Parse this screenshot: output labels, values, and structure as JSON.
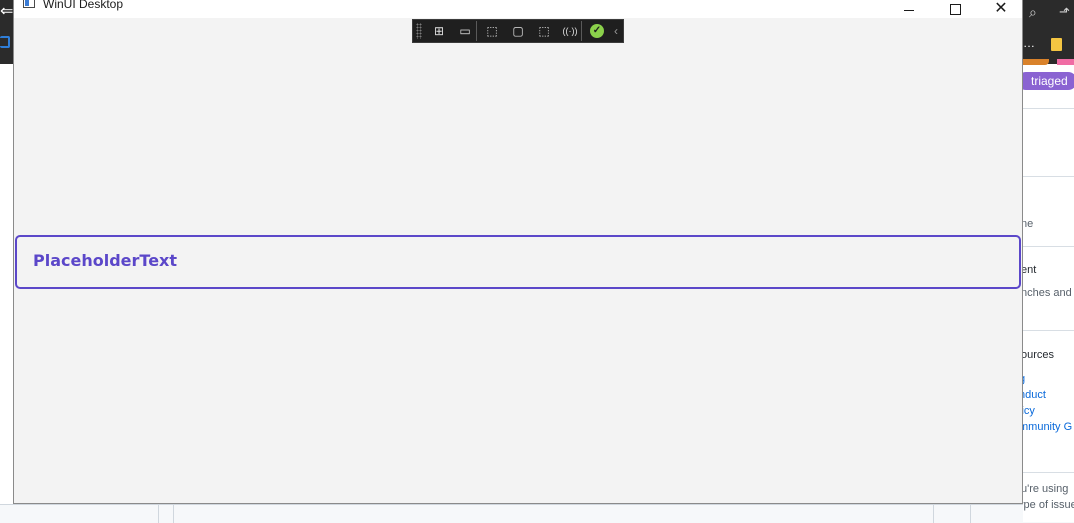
{
  "window": {
    "title": "WinUI Desktop",
    "controls": {
      "minimize": "–",
      "maximize": "□",
      "close": "✕"
    }
  },
  "debug_toolbar": {
    "buttons": [
      {
        "name": "live-visual-tree-icon",
        "glyph": "⊞"
      },
      {
        "name": "record-icon",
        "glyph": "▭"
      },
      {
        "name": "select-element-icon",
        "glyph": "⬚"
      },
      {
        "name": "display-layout-adorners-icon",
        "glyph": "▢"
      },
      {
        "name": "track-focus-icon",
        "glyph": "⬚"
      },
      {
        "name": "hot-reload-icon",
        "glyph": "((·))"
      },
      {
        "name": "accessibility-check-icon",
        "glyph": "✓"
      }
    ],
    "collapse_glyph": "‹"
  },
  "text_field": {
    "placeholder": "PlaceholderText",
    "accent": "#5b47c9"
  },
  "background_app": {
    "badge": "triaged",
    "text_items": [
      "ne",
      "ent",
      "nches and p",
      "ources",
      "g",
      "nduct",
      "licy",
      "mmunity G",
      "u're using",
      "type of issue"
    ]
  },
  "colors": {
    "window_bg": "#f3f3f3",
    "toolbar_bg": "#1f1f1f",
    "badge_bg": "#8a63d2",
    "link": "#0969da"
  }
}
